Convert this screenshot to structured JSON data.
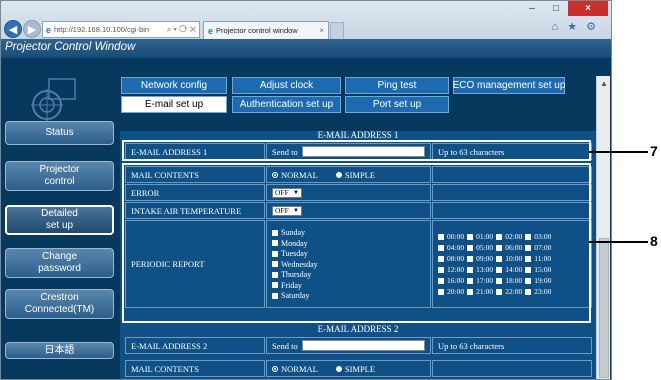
{
  "browser": {
    "url": "http://192.168.10.100/cgi-bin",
    "tab_title": "Projector control window",
    "tab_close": "×",
    "window_buttons": [
      "–",
      "□",
      "×"
    ],
    "toolbar_icons": "⌂ ★ ⚙"
  },
  "page": {
    "title": "Projector Control Window",
    "nav_tabs": [
      {
        "label": "Network config"
      },
      {
        "label": "Adjust clock"
      },
      {
        "label": "Ping test"
      },
      {
        "label": "ECO management set up"
      },
      {
        "label": "E-mail set up",
        "active": true
      },
      {
        "label": "Authentication set up"
      },
      {
        "label": "Port set up"
      }
    ],
    "side_menu": [
      {
        "label": "Status"
      },
      {
        "label": "Projector\ncontrol"
      },
      {
        "label": "Detailed\nset up",
        "active": true
      },
      {
        "label": "Change\npassword"
      },
      {
        "label": "Crestron\nConnected(TM)"
      },
      {
        "label": "日本語"
      }
    ]
  },
  "email1": {
    "section_title": "E-MAIL ADDRESS 1",
    "address_label": "E-MAIL ADDRESS 1",
    "send_to": "Send to",
    "input_value": "",
    "limit": "Up to 63 characters",
    "mail_contents_label": "MAIL CONTENTS",
    "mail_options": [
      {
        "label": "NORMAL",
        "selected": true
      },
      {
        "label": "SIMPLE",
        "selected": false
      }
    ],
    "error_label": "ERROR",
    "error_value": "OFF",
    "intake_label": "INTAKE AIR TEMPERATURE",
    "intake_value": "OFF",
    "periodic_label": "PERIODIC REPORT",
    "days": [
      "Sunday",
      "Monday",
      "Tuesday",
      "Wednesday",
      "Thursday",
      "Friday",
      "Saturday"
    ],
    "hours": [
      "00:00",
      "01:00",
      "02:00",
      "03:00",
      "04:00",
      "05:00",
      "06:00",
      "07:00",
      "08:00",
      "09:00",
      "10:00",
      "11:00",
      "12:00",
      "13:00",
      "14:00",
      "15:00",
      "16:00",
      "17:00",
      "18:00",
      "19:00",
      "20:00",
      "21:00",
      "22:00",
      "23:00"
    ]
  },
  "email2": {
    "section_title": "E-MAIL ADDRESS 2",
    "address_label": "E-MAIL ADDRESS 2",
    "send_to": "Send to",
    "input_value": "",
    "limit": "Up to 63 characters",
    "mail_contents_label": "MAIL CONTENTS",
    "mail_options": [
      {
        "label": "NORMAL",
        "selected": true
      },
      {
        "label": "SIMPLE",
        "selected": false
      }
    ]
  },
  "callouts": [
    "7",
    "8"
  ],
  "colors": {
    "page_background": "#07385e",
    "content_background": "#0f5187",
    "tab_blue": "#1e6ab0",
    "callout": "#000000"
  }
}
